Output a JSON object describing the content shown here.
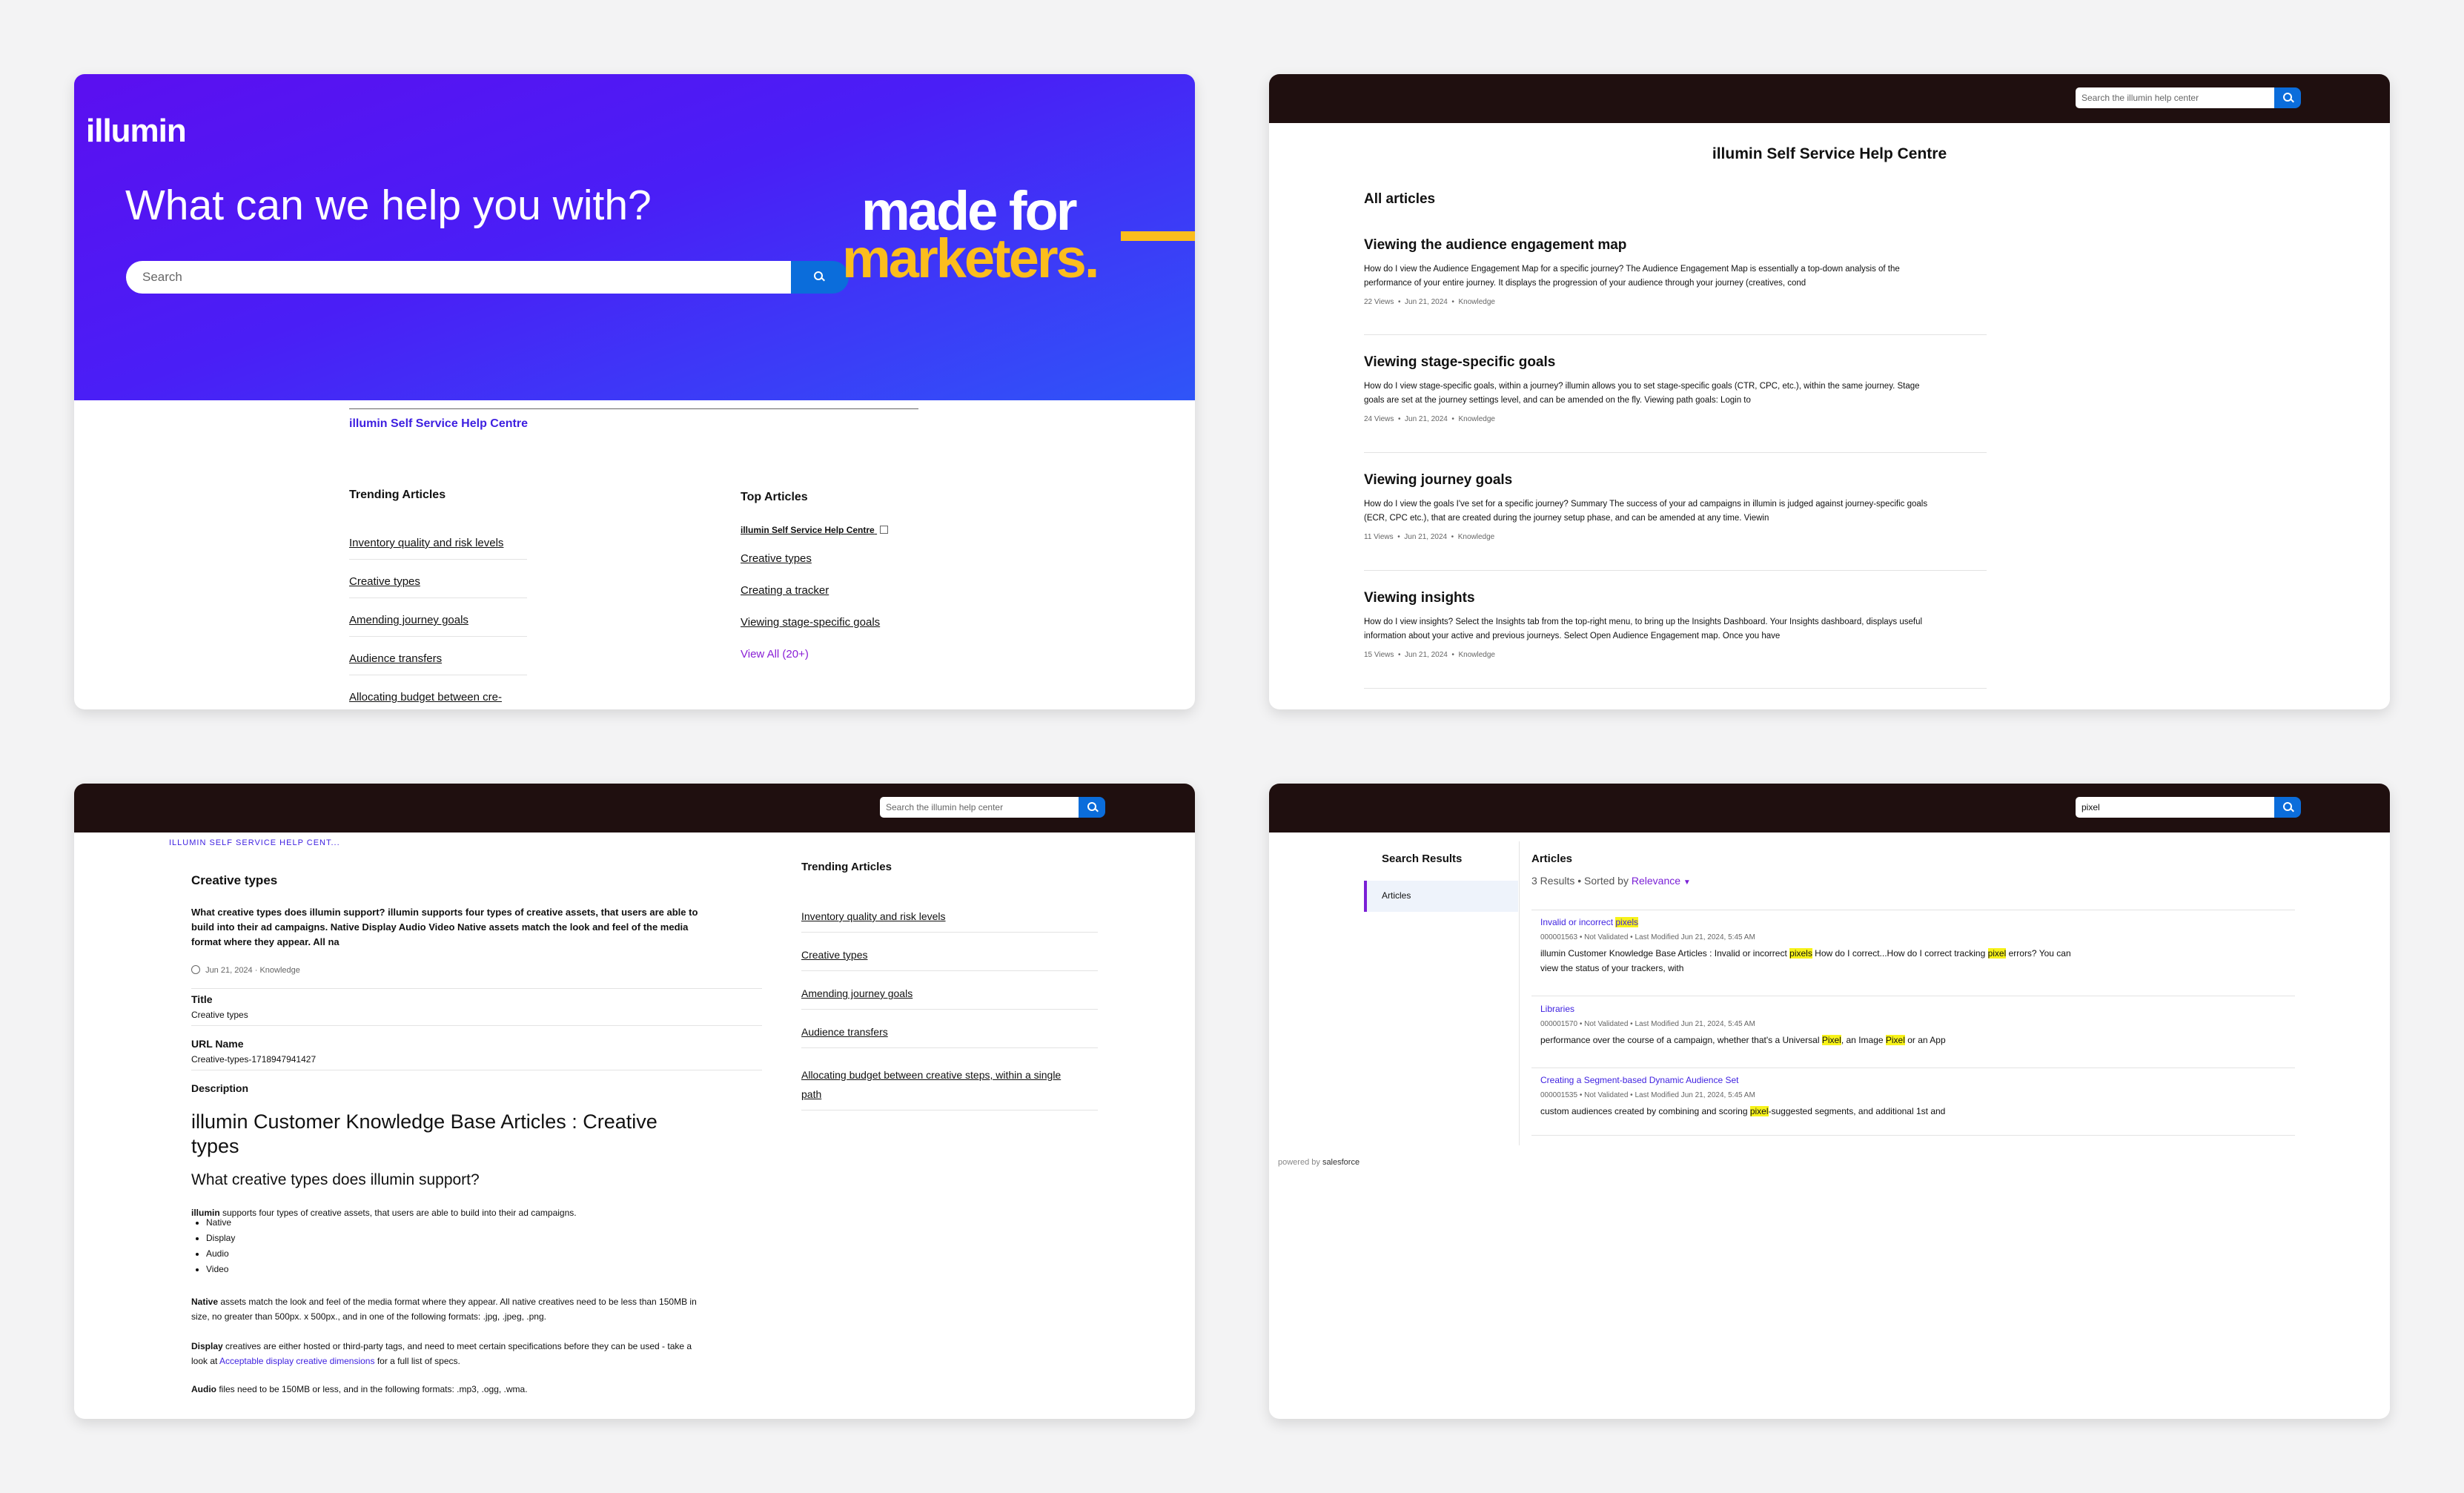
{
  "panel1": {
    "logo": "illumin",
    "headline": "What can we help you with?",
    "search_placeholder": "Search",
    "tagline_line1": "made for",
    "tagline_line2": "marketers.",
    "breadcrumb": "illumin Self Service Help Centre",
    "trending": {
      "title": "Trending Articles",
      "items": [
        "Inventory quality and risk levels",
        "Creative types",
        "Amending journey goals",
        "Audience transfers",
        "Allocating budget between cre-"
      ]
    },
    "top": {
      "title": "Top Articles",
      "items": [
        "illumin Self Service Help Centre",
        "Creative types",
        "Creating a tracker",
        "Viewing stage-specific goals"
      ],
      "view_all": "View All (20+)"
    }
  },
  "panel2": {
    "search_placeholder": "Search the illumin help center",
    "title": "illumin Self Service Help Centre",
    "section": "All articles",
    "articles": [
      {
        "title": "Viewing the audience engagement map",
        "line1": "How do I view the Audience Engagement Map for a specific journey? The Audience Engagement Map is essentially a top-down analysis of the",
        "line2": "performance of your entire journey. It displays the progression of your audience through your journey (creatives, cond",
        "views": "22 Views",
        "date": "Jun 21, 2024",
        "type": "Knowledge"
      },
      {
        "title": "Viewing stage-specific goals",
        "line1": "How do I view stage-specific goals, within a journey? illumin allows you to set stage-specific goals (CTR, CPC, etc.), within the same journey. Stage",
        "line2": "goals are set at the journey settings level, and can be amended on the fly. Viewing path goals: Login to",
        "views": "24 Views",
        "date": "Jun 21, 2024",
        "type": "Knowledge"
      },
      {
        "title": "Viewing journey goals",
        "line1": "How do I view the goals I've set for a specific journey? Summary The success of your ad campaigns in illumin is judged against journey-specific goals",
        "line2": "(ECR, CPC etc.), that are created during the journey setup phase, and can be amended at any time. Viewin",
        "views": "11 Views",
        "date": "Jun 21, 2024",
        "type": "Knowledge"
      },
      {
        "title": "Viewing insights",
        "line1": "How do I view insights? Select the Insights tab from the top-right menu, to bring up the Insights Dashboard. Your Insights dashboard, displays useful",
        "line2": "information about your active and previous journeys. Select Open Audience Engagement map. Once you have",
        "views": "15 Views",
        "date": "Jun 21, 2024",
        "type": "Knowledge"
      }
    ]
  },
  "panel3": {
    "search_placeholder": "Search the illumin help center",
    "breadcrumb": "ILLUMIN SELF SERVICE HELP CENT...",
    "title": "Creative types",
    "summary_l1": "What creative types does illumin support? illumin supports four types of creative assets, that users are able to",
    "summary_l2": "build into their ad campaigns. Native Display Audio Video Native assets match the look and feel of the media",
    "summary_l3": "format where they appear. All na",
    "date": "Jun 21, 2024",
    "type": "Knowledge",
    "field_title_label": "Title",
    "field_title_value": "Creative types",
    "field_url_label": "URL Name",
    "field_url_value": "Creative-types-1718947941427",
    "field_desc_label": "Description",
    "h1_l1": "illumin Customer Knowledge Base Articles : Creative",
    "h1_l2": "types",
    "h2": "What creative types does illumin support?",
    "intro_bold": "illumin",
    "intro_rest": " supports four types of creative assets, that users are able to build into their ad campaigns.",
    "bullets": [
      "Native",
      "Display",
      "Audio",
      "Video"
    ],
    "native_bold": "Native",
    "native_l1": " assets match the look and feel of the media format where they appear. All native creatives need to be less than 150MB in",
    "native_l2": "size, no greater than 500px. x 500px., and in one of the following formats: .jpg, .jpeg, .png.",
    "display_bold": "Display",
    "display_l1": " creatives are either hosted or third-party tags, and need to meet certain specifications before they can be used - take a",
    "display_l2a": "look at ",
    "display_link": "Acceptable display creative dimensions",
    "display_l2b": " for a full list of specs.",
    "audio_bold": "Audio",
    "audio_rest": " files need to be 150MB or less, and in the following formats: .mp3, .ogg, .wma.",
    "trending_title": "Trending Articles",
    "trending_items": [
      "Inventory quality and risk levels",
      "Creative types",
      "Amending journey goals",
      "Audience transfers"
    ],
    "trending_last_l1": "Allocating budget between creative steps, within a single",
    "trending_last_l2": "path"
  },
  "panel4": {
    "search_value": "pixel",
    "sidebar_title": "Search Results",
    "sidebar_item": "Articles",
    "heading": "Articles",
    "count": "3 Results",
    "sorted_by": "Sorted by",
    "sort_value": "Relevance",
    "r1_title_a": "Invalid or incorrect ",
    "r1_title_hl": "pixels",
    "r1_meta": "000001563  •  Not Validated  •  Last Modified  Jun 21, 2024, 5:45 AM",
    "r1_s_a": "illumin Customer Knowledge Base Articles : Invalid or incorrect ",
    "r1_s_hl1": "pixels",
    "r1_s_b": " How do I correct...How do I correct tracking ",
    "r1_s_hl2": "pixel",
    "r1_s_c": " errors? You can",
    "r1_s_l2": "view the status of your trackers, with",
    "r2_title": "Libraries",
    "r2_meta": "000001570  •  Not Validated  •  Last Modified  Jun 21, 2024, 5:45 AM",
    "r2_s_a": "performance over the course of a campaign, whether that's a Universal ",
    "r2_s_hl1": "Pixel",
    "r2_s_b": ", an Image ",
    "r2_s_hl2": "Pixel",
    "r2_s_c": " or an App",
    "r3_title": "Creating a Segment-based Dynamic Audience Set",
    "r3_meta": "000001535  •  Not Validated  •  Last Modified  Jun 21, 2024, 5:45 AM",
    "r3_s_a": "custom audiences created by combining and scoring ",
    "r3_s_hl": "pixel",
    "r3_s_b": "-suggested segments, and additional 1st and",
    "powered_by": "powered by",
    "powered_brand": "salesforce"
  }
}
